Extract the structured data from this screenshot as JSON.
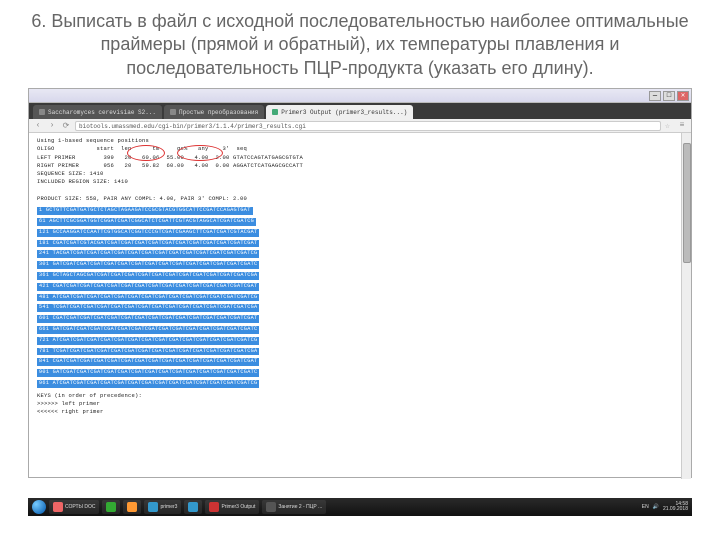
{
  "slide": {
    "title": "6. Выписать в файл с исходной последовательностью наиболее оптимальные праймеры (прямой и обратный), их температуры плавления и последовательность ПЦР-продукта (указать его длину)."
  },
  "window": {
    "min": "—",
    "max": "□",
    "close": "✕"
  },
  "tabs": [
    {
      "label": "Saccharomyces cerevisiae S2..."
    },
    {
      "label": "Простые преобразования"
    },
    {
      "label": "Primer3 Output (primer3_results...)"
    }
  ],
  "nav": {
    "back": "‹",
    "fwd": "›",
    "reload": "⟳",
    "url": "biotools.umassmed.edu/cgi-bin/primer3/1.1.4/primer3_results.cgi",
    "star": "☆",
    "menu": "≡"
  },
  "output": {
    "header1": "Using 1-based sequence positions",
    "header2": "OLIGO            start  len      tm     gc%   any    3'  seq",
    "left": "LEFT PRIMER        399   20   60.06  55.00   4.00  2.00 GTATCCAGTATGAGCGTGTA",
    "right": "RIGHT PRIMER       956   20   59.82  60.00   4.00  0.00 AGGATCTCATGAGCGCCATT",
    "seqsize": "SEQUENCE SIZE: 1410",
    "included": "INCLUDED REGION SIZE: 1410",
    "product": "PRODUCT SIZE: 558, PAIR ANY COMPL: 4.00, PAIR 3' COMPL: 2.00",
    "rows": [
      "  1 GCTGTTCGATGATGCTCTAGCTAGAAGATCCGCGTACGTGGCATTCCGATCCAGAGTGAT",
      " 61 AGCTTCGCGGATGGTCGGATCGATCGGCATCTCGATTCGTACGTAGGCATCGATCGATCG",
      "121 GCCAAGGATCCAATTCGTGGCATCGGTCCCGTCGATCGAAGCTTCGATCGATCGTACGAT",
      "181 CGATCGATCGTACGATCGATCGATCGATCGATCGATCGATCGATCGATCGATCGATCGAT",
      "241 TACGATCGATCGATCGATCGATCGATCGATCGATCGATCGATCGATCGATCGATCGATCG",
      "301 GATCGATCGATCGATCGATCGATCGATCGATCGATCGATCGATCGATCGATCGATCGATC",
      "361 GCTAGCTAGCGATCGATCGATCGATCGATCGATCGATCGATCGATCGATCGATCGATCGA",
      "421 CGATCGATCGATCGATCGATCGATCGATCGATCGATCGATCGATCGATCGATCGATCGAT",
      "481 ATCGATCGATCGATCGATCGATCGATCGATCGATCGATCGATCGATCGATCGATCGATCG",
      "541 TCGATCGATCGATCGATCGATCGATCGATCGATCGATCGATCGATCGATCGATCGATCGA",
      "601 CGATCGATCGATCGATCGATCGATCGATCGATCGATCGATCGATCGATCGATCGATCGAT",
      "661 GATCGATCGATCGATCGATCGATCGATCGATCGATCGATCGATCGATCGATCGATCGATC",
      "721 ATCGATCGATCGATCGATCGATCGATCGATCGATCGATCGATCGATCGATCGATCGATCG",
      "781 TCGATCGATCGATCGATCGATCGATCGATCGATCGATCGATCGATCGATCGATCGATCGA",
      "841 CGATCGATCGATCGATCGATCGATCGATCGATCGATCGATCGATCGATCGATCGATCGAT",
      "901 GATCGATCGATCGATCGATCGATCGATCGATCGATCGATCGATCGATCGATCGATCGATC",
      "961 ATCGATCGATCGATCGATCGATCGATCGATCGATCGATCGATCGATCGATCGATCGATCG"
    ],
    "keys_title": "KEYS (in order of precedence):",
    "key_left": ">>>>>> left primer",
    "key_right": "<<<<<< right primer"
  },
  "taskbar": {
    "items": [
      {
        "label": "СОРТЫ DOC"
      },
      {
        "label": ""
      },
      {
        "label": ""
      },
      {
        "label": "primer3"
      },
      {
        "label": ""
      },
      {
        "label": "Primer3 Output"
      },
      {
        "label": "Занятие 2 - ПЦР ..."
      }
    ],
    "lang": "EN",
    "time": "14:58",
    "date": "21.09.2018"
  }
}
